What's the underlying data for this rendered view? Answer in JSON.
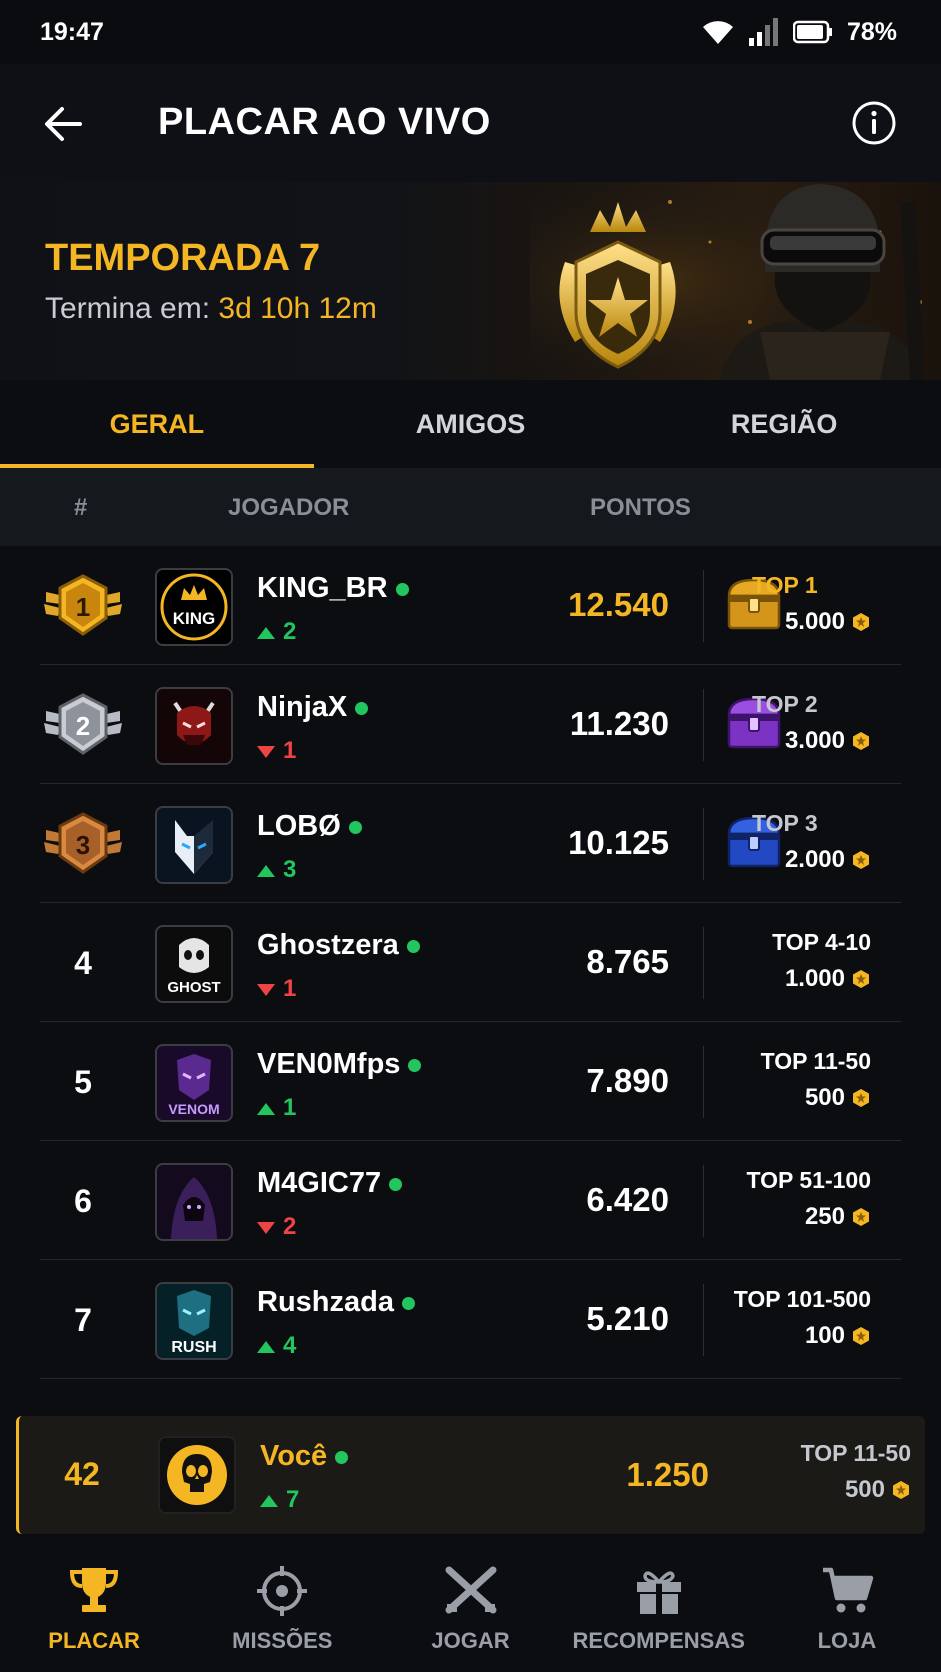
{
  "status_bar": {
    "time": "19:47",
    "battery": "78%"
  },
  "header": {
    "title": "PLACAR AO VIVO"
  },
  "banner": {
    "season": "TEMPORADA 7",
    "ends_label": "Termina em:",
    "ends_time": "3d 10h 12m"
  },
  "tabs": [
    {
      "label": "GERAL",
      "active": true
    },
    {
      "label": "AMIGOS",
      "active": false
    },
    {
      "label": "REGIÃO",
      "active": false
    }
  ],
  "columns": {
    "rank": "#",
    "player": "JOGADOR",
    "points": "PONTOS"
  },
  "rows": [
    {
      "rank": "1",
      "name": "KING_BR",
      "avatar_text": "KING",
      "change": "2",
      "dir": "up",
      "points": "12.540",
      "tier": "TOP 1",
      "reward": "5.000"
    },
    {
      "rank": "2",
      "name": "NinjaX",
      "avatar_text": "",
      "change": "1",
      "dir": "down",
      "points": "11.230",
      "tier": "TOP 2",
      "reward": "3.000"
    },
    {
      "rank": "3",
      "name": "LOBØ",
      "avatar_text": "",
      "change": "3",
      "dir": "up",
      "points": "10.125",
      "tier": "TOP 3",
      "reward": "2.000"
    },
    {
      "rank": "4",
      "name": "Ghostzera",
      "avatar_text": "GHOST",
      "change": "1",
      "dir": "down",
      "points": "8.765",
      "tier": "TOP 4-10",
      "reward": "1.000"
    },
    {
      "rank": "5",
      "name": "VEN0Mfps",
      "avatar_text": "VENOM",
      "change": "1",
      "dir": "up",
      "points": "7.890",
      "tier": "TOP 11-50",
      "reward": "500"
    },
    {
      "rank": "6",
      "name": "M4GIC77",
      "avatar_text": "",
      "change": "2",
      "dir": "down",
      "points": "6.420",
      "tier": "TOP 51-100",
      "reward": "250"
    },
    {
      "rank": "7",
      "name": "Rushzada",
      "avatar_text": "RUSH",
      "change": "4",
      "dir": "up",
      "points": "5.210",
      "tier": "TOP 101-500",
      "reward": "100"
    }
  ],
  "you": {
    "rank": "42",
    "name": "Você",
    "change": "7",
    "dir": "up",
    "points": "1.250",
    "tier": "TOP 11-50",
    "reward": "500"
  },
  "bottom_nav": [
    {
      "label": "PLACAR",
      "icon": "trophy-icon",
      "active": true
    },
    {
      "label": "MISSÕES",
      "icon": "crosshair-icon",
      "active": false
    },
    {
      "label": "JOGAR",
      "icon": "crossed-guns-icon",
      "active": false
    },
    {
      "label": "RECOMPENSAS",
      "icon": "gift-icon",
      "active": false
    },
    {
      "label": "LOJA",
      "icon": "cart-icon",
      "active": false
    }
  ],
  "colors": {
    "accent": "#f5b623",
    "up": "#22c55e",
    "down": "#ef4444",
    "background": "#0b0d11"
  }
}
